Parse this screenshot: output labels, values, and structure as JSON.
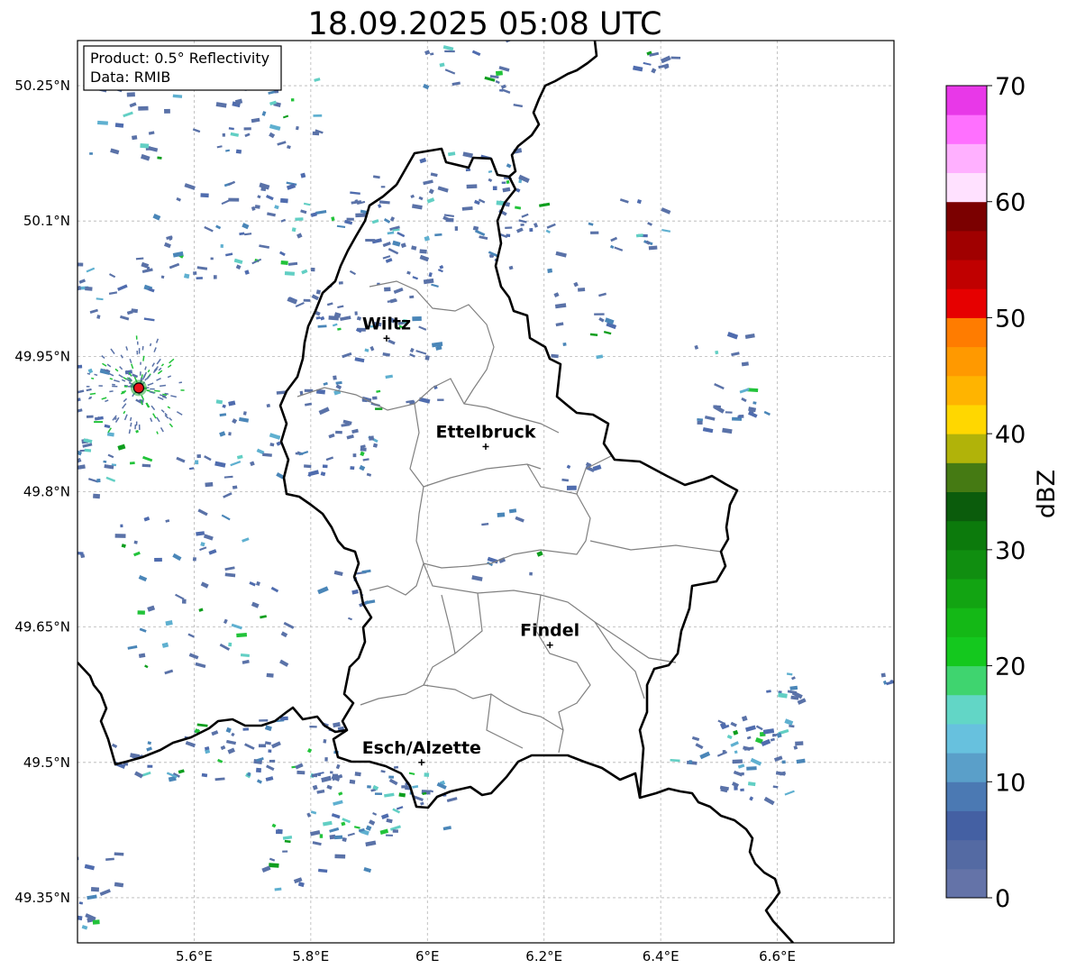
{
  "title": "18.09.2025 05:08 UTC",
  "info_box": {
    "product": "Product: 0.5° Reflectivity",
    "source": "Data: RMIB"
  },
  "map_extent": {
    "lon_min": 5.4,
    "lon_max": 6.8,
    "lat_min": 49.3,
    "lat_max": 50.3
  },
  "lat_ticks": [
    {
      "value": 50.25,
      "label": "50.25°N"
    },
    {
      "value": 50.1,
      "label": "50.1°N"
    },
    {
      "value": 49.95,
      "label": "49.95°N"
    },
    {
      "value": 49.8,
      "label": "49.8°N"
    },
    {
      "value": 49.65,
      "label": "49.65°N"
    },
    {
      "value": 49.5,
      "label": "49.5°N"
    },
    {
      "value": 49.35,
      "label": "49.35°N"
    }
  ],
  "lon_ticks": [
    {
      "value": 5.6,
      "label": "5.6°E"
    },
    {
      "value": 5.8,
      "label": "5.8°E"
    },
    {
      "value": 6.0,
      "label": "6°E"
    },
    {
      "value": 6.2,
      "label": "6.2°E"
    },
    {
      "value": 6.4,
      "label": "6.4°E"
    },
    {
      "value": 6.6,
      "label": "6.6°E"
    }
  ],
  "cities": [
    {
      "name": "Wiltz",
      "lon": 5.93,
      "lat": 49.97
    },
    {
      "name": "Ettelbruck",
      "lon": 6.1,
      "lat": 49.85
    },
    {
      "name": "Findel",
      "lon": 6.21,
      "lat": 49.63
    },
    {
      "name": "Esch/Alzette",
      "lon": 5.99,
      "lat": 49.5
    }
  ],
  "radar_site": {
    "lon": 5.505,
    "lat": 49.915,
    "color": "#e8131a"
  },
  "colorbar": {
    "label": "dBZ",
    "min": 0,
    "max": 70,
    "ticks": [
      "0",
      "10",
      "20",
      "30",
      "40",
      "50",
      "60",
      "70"
    ],
    "colors": [
      "#6473a8",
      "#546aa3",
      "#4460a3",
      "#4b79b3",
      "#5a9fc9",
      "#67c1de",
      "#62d6c6",
      "#3fd46f",
      "#14c81e",
      "#14b816",
      "#12a412",
      "#108e10",
      "#0c7a0c",
      "#0b5c0c",
      "#457a13",
      "#b1b309",
      "#ffd700",
      "#ffb400",
      "#ff9900",
      "#ff7c00",
      "#e60000",
      "#c00000",
      "#a00000",
      "#7b0000",
      "#ffe1ff",
      "#ffb0ff",
      "#ff70ff",
      "#e838e8"
    ]
  },
  "echo_palette": [
    "#5a72a8",
    "#4f6cae",
    "#4a86b8",
    "#5fb0d0",
    "#62cfc4",
    "#22c33a",
    "#0e9e1e"
  ]
}
